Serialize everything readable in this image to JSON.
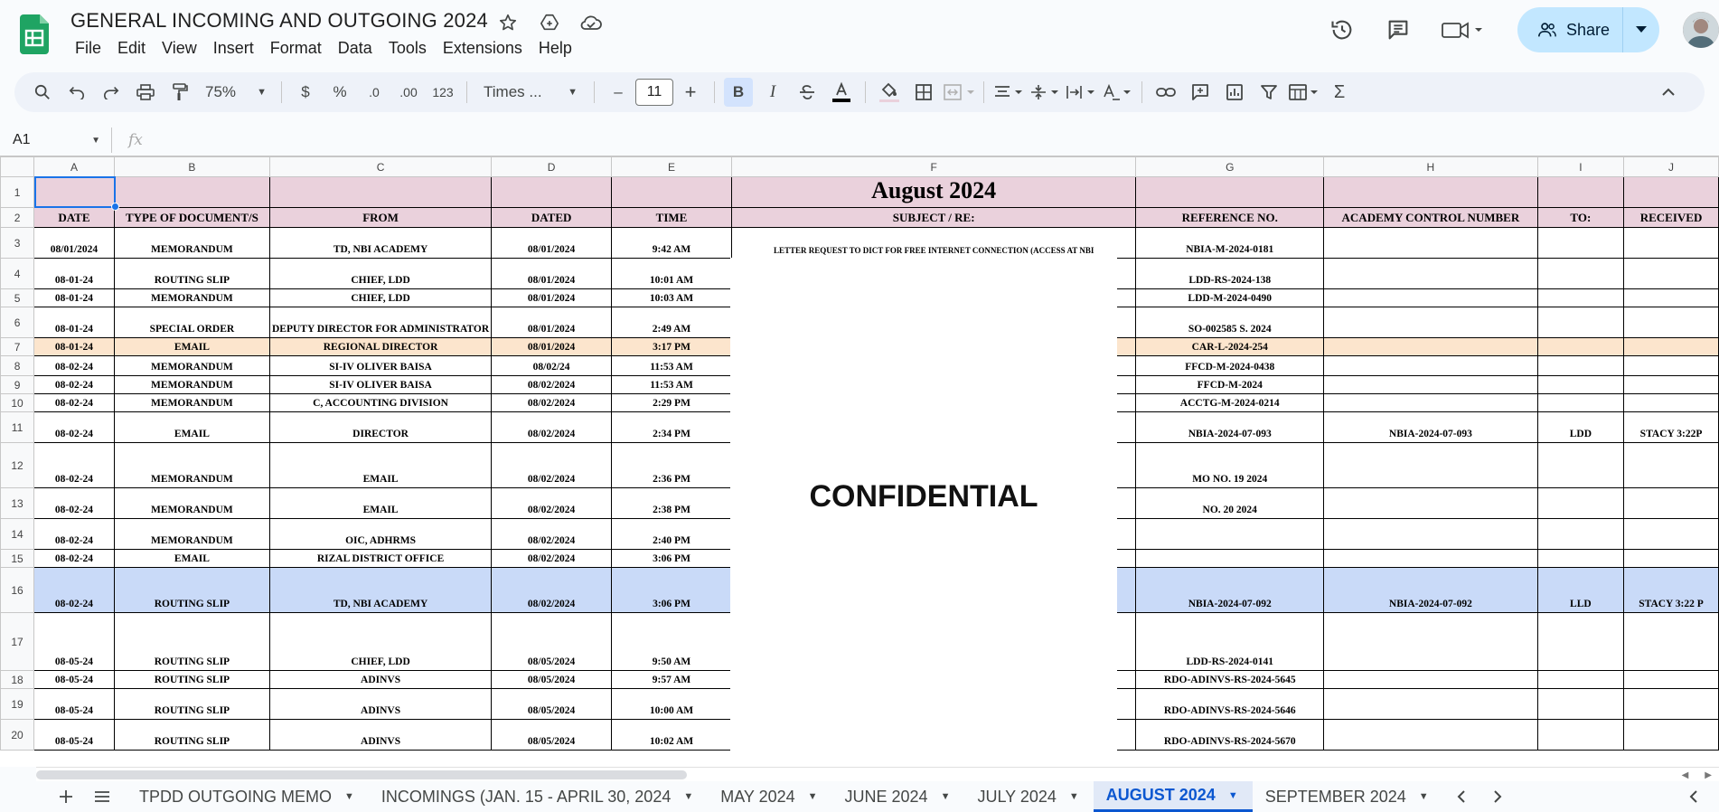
{
  "app": {
    "doc_title": "GENERAL INCOMING AND OUTGOING 2024",
    "menu": [
      "File",
      "Edit",
      "View",
      "Insert",
      "Format",
      "Data",
      "Tools",
      "Extensions",
      "Help"
    ],
    "share_label": "Share",
    "accent": "#0b57d0",
    "share_bg": "#c2e7ff"
  },
  "toolbar": {
    "zoom": "75%",
    "currency": "$",
    "percent": "%",
    "dec_decrease": ".0",
    "dec_increase": ".00",
    "number_format": "123",
    "font": "Times ...",
    "font_size": "11",
    "minus": "–",
    "plus": "+",
    "bold": "B",
    "italic": "I",
    "sum": "Σ"
  },
  "formula_bar": {
    "cell_ref": "A1",
    "fx": "fx"
  },
  "columns": [
    "A",
    "B",
    "C",
    "D",
    "E",
    "F",
    "G",
    "H",
    "I",
    "J"
  ],
  "sheet": {
    "month_title": "August 2024",
    "headers": [
      "DATE",
      "TYPE OF DOCUMENT/S",
      "FROM",
      "DATED",
      "TIME",
      "SUBJECT / RE:",
      "REFERENCE NO.",
      "ACADEMY CONTROL NUMBER",
      "TO:",
      "RECEIVED"
    ],
    "rows": [
      {
        "num": "3",
        "cells": [
          "08/01/2024",
          "MEMORANDUM",
          "TD, NBI ACADEMY",
          "08/01/2024",
          "9:42 AM",
          "LETTER REQUEST TO DICT FOR FREE INTERNET CONNECTION (ACCESS AT NBI",
          "NBIA-M-2024-0181",
          "",
          "",
          ""
        ]
      },
      {
        "num": "4",
        "cells": [
          "08-01-24",
          "ROUTING SLIP",
          "CHIEF, LDD",
          "08/01/2024",
          "10:01 AM",
          "",
          "LDD-RS-2024-138",
          "",
          "",
          ""
        ]
      },
      {
        "num": "5",
        "cells": [
          "08-01-24",
          "MEMORANDUM",
          "CHIEF, LDD",
          "08/01/2024",
          "10:03 AM",
          "",
          "LDD-M-2024-0490",
          "",
          "",
          ""
        ]
      },
      {
        "num": "6",
        "cells": [
          "08-01-24",
          "SPECIAL ORDER",
          "DEPUTY DIRECTOR FOR ADMINISTRATOR",
          "08/01/2024",
          "2:49 AM",
          "",
          "SO-002585 S. 2024",
          "",
          "",
          ""
        ]
      },
      {
        "num": "7",
        "cells": [
          "08-01-24",
          "EMAIL",
          "REGIONAL DIRECTOR",
          "08/01/2024",
          "3:17 PM",
          "",
          "CAR-L-2024-254",
          "",
          "",
          ""
        ]
      },
      {
        "num": "8",
        "cells": [
          "08-02-24",
          "MEMORANDUM",
          "SI-IV OLIVER BAISA",
          "08/02/24",
          "11:53 AM",
          "",
          "FFCD-M-2024-0438",
          "",
          "",
          ""
        ]
      },
      {
        "num": "9",
        "cells": [
          "08-02-24",
          "MEMORANDUM",
          "SI-IV OLIVER BAISA",
          "08/02/2024",
          "11:53 AM",
          "",
          "FFCD-M-2024",
          "",
          "",
          ""
        ]
      },
      {
        "num": "10",
        "cells": [
          "08-02-24",
          "MEMORANDUM",
          "C, ACCOUNTING DIVISION",
          "08/02/2024",
          "2:29 PM",
          "",
          "ACCTG-M-2024-0214",
          "",
          "",
          ""
        ]
      },
      {
        "num": "11",
        "cells": [
          "08-02-24",
          "EMAIL",
          "DIRECTOR",
          "08/02/2024",
          "2:34 PM",
          "",
          "NBIA-2024-07-093",
          "NBIA-2024-07-093",
          "LDD",
          "STACY 3:22P"
        ]
      },
      {
        "num": "12",
        "cells": [
          "08-02-24",
          "MEMORANDUM",
          "EMAIL",
          "08/02/2024",
          "2:36 PM",
          "",
          "MO NO. 19 2024",
          "",
          "",
          ""
        ]
      },
      {
        "num": "13",
        "cells": [
          "08-02-24",
          "MEMORANDUM",
          "EMAIL",
          "08/02/2024",
          "2:38 PM",
          "",
          "NO. 20 2024",
          "",
          "",
          ""
        ]
      },
      {
        "num": "14",
        "cells": [
          "08-02-24",
          "MEMORANDUM",
          "OIC, ADHRMS",
          "08/02/2024",
          "2:40 PM",
          "",
          "",
          "",
          "",
          ""
        ]
      },
      {
        "num": "15",
        "cells": [
          "08-02-24",
          "EMAIL",
          "RIZAL DISTRICT OFFICE",
          "08/02/2024",
          "3:06 PM",
          "",
          "",
          "",
          "",
          ""
        ]
      },
      {
        "num": "16",
        "cells": [
          "08-02-24",
          "ROUTING SLIP",
          "TD, NBI ACADEMY",
          "08/02/2024",
          "3:06 PM",
          "",
          "NBIA-2024-07-092",
          "NBIA-2024-07-092",
          "LLD",
          "STACY 3:22 P"
        ]
      },
      {
        "num": "17",
        "cells": [
          "08-05-24",
          "ROUTING SLIP",
          "CHIEF, LDD",
          "08/05/2024",
          "9:50 AM",
          "",
          "LDD-RS-2024-0141",
          "",
          "",
          ""
        ]
      },
      {
        "num": "18",
        "cells": [
          "08-05-24",
          "ROUTING SLIP",
          "ADINVS",
          "08/05/2024",
          "9:57 AM",
          "",
          "RDO-ADINVS-RS-2024-5645",
          "",
          "",
          ""
        ]
      },
      {
        "num": "19",
        "cells": [
          "08-05-24",
          "ROUTING SLIP",
          "ADINVS",
          "08/05/2024",
          "10:00 AM",
          "",
          "RDO-ADINVS-RS-2024-5646",
          "",
          "",
          ""
        ]
      },
      {
        "num": "20",
        "cells": [
          "08-05-24",
          "ROUTING SLIP",
          "ADINVS",
          "08/05/2024",
          "10:02 AM",
          "",
          "RDO-ADINVS-RS-2024-5670",
          "",
          "",
          ""
        ]
      }
    ],
    "overlay_text": "CONFIDENTIAL",
    "row_colors": {
      "pink": "#ead1dc",
      "peach": "#fce5cd",
      "blue": "#c9daf8"
    }
  },
  "tabs": [
    {
      "label": "TPDD OUTGOING MEMO",
      "active": false
    },
    {
      "label": "INCOMINGS (JAN. 15 - APRIL 30, 2024",
      "active": false
    },
    {
      "label": "MAY 2024",
      "active": false
    },
    {
      "label": "JUNE 2024",
      "active": false
    },
    {
      "label": "JULY 2024",
      "active": false
    },
    {
      "label": "AUGUST 2024",
      "active": true
    },
    {
      "label": "SEPTEMBER 2024",
      "active": false
    }
  ]
}
